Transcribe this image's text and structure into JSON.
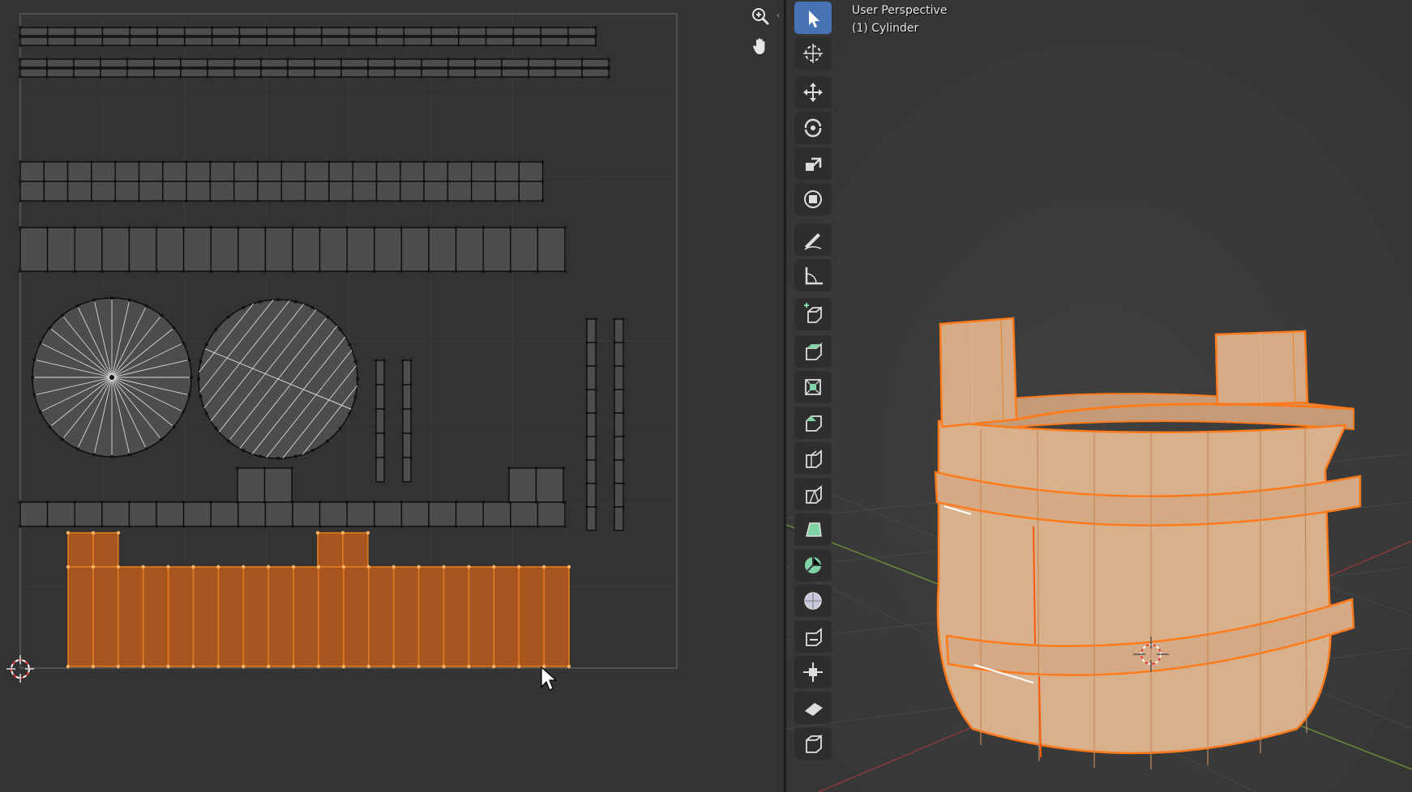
{
  "viewport": {
    "perspective_label": "User Perspective",
    "object_label": "(1) Cylinder"
  },
  "uv_editor": {
    "nav_icons": [
      "zoom-icon",
      "hand-pan-icon"
    ],
    "uv_islands": [
      "top-row-strip-1",
      "top-row-strip-2",
      "double-band-strip",
      "wide-band-strip",
      "round-lid-fan",
      "round-lid-planks",
      "vertical-strip-pair-small",
      "vertical-strip-pair-tall",
      "handle-strip",
      "selected-bucket-walls"
    ],
    "selection_color": "#e07a1f"
  },
  "toolbar": {
    "tools": [
      {
        "name": "select-box",
        "active": true
      },
      {
        "name": "cursor"
      },
      {
        "name": "move"
      },
      {
        "name": "rotate"
      },
      {
        "name": "scale"
      },
      {
        "name": "transform"
      },
      {
        "name": "annotate"
      },
      {
        "name": "measure"
      },
      {
        "name": "add-cube"
      },
      {
        "name": "extrude-region"
      },
      {
        "name": "inset-faces"
      },
      {
        "name": "bevel"
      },
      {
        "name": "loop-cut"
      },
      {
        "name": "knife"
      },
      {
        "name": "poly-build"
      },
      {
        "name": "spin"
      },
      {
        "name": "smooth"
      },
      {
        "name": "edge-slide"
      },
      {
        "name": "shrink-fatten"
      },
      {
        "name": "shear"
      },
      {
        "name": "rip-region"
      }
    ]
  },
  "colors": {
    "editor_bg": "#333333",
    "viewport_bg": "#3b3b3b",
    "active_tool": "#4772b3",
    "object_fill": "#d9b08c",
    "object_outline": "#ff7a1a"
  }
}
